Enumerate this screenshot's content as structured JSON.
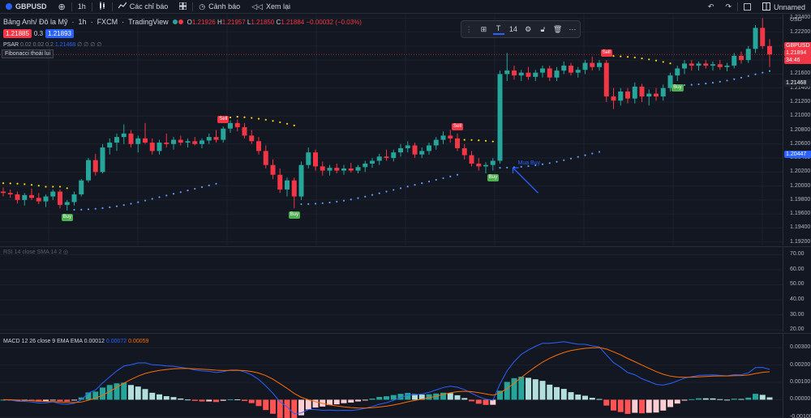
{
  "topbar": {
    "symbol": "GBPUSD",
    "interval": "1h",
    "indicators_label": "Các chỉ báo",
    "alerts_label": "Cảnh báo",
    "replay_label": "Xem lại",
    "layout_name": "Unnamed"
  },
  "legend": {
    "title": "Bảng Anh/ Đô la Mỹ",
    "interval": "1h",
    "exchange": "FXCM",
    "source": "TradingView",
    "o_label": "O",
    "o": "1.21926",
    "h_label": "H",
    "h": "1.21957",
    "l_label": "L",
    "l": "1.21850",
    "c_label": "C",
    "c": "1.21884",
    "change": "−0.00032 (−0.03%)",
    "bid": "1.21885",
    "spread": "0.3",
    "ask": "1.21893"
  },
  "psar": {
    "label": "PSAR",
    "params": "0.02 0.02 0.2",
    "value": "1.21468",
    "extra": "∅ ∅ ∅ ∅"
  },
  "fib_tag": "Fibonacci thoái lui",
  "drawing_toolbar": {
    "size": "14"
  },
  "signals": {
    "sell": "Sell",
    "buy": "Buy",
    "note": "Mua Buy"
  },
  "price_scale": {
    "currency": "USD",
    "ticks": [
      "1.22400",
      "1.22200",
      "1.22000",
      "1.21800",
      "1.21600",
      "1.21400",
      "1.21200",
      "1.21000",
      "1.20800",
      "1.20600",
      "1.20400",
      "1.20200",
      "1.20000",
      "1.19800",
      "1.19600",
      "1.19400",
      "1.19200"
    ],
    "symbol_label": "GBPUSD",
    "current_price": "1.21894",
    "countdown": "34:46",
    "psar_price": "1.21468",
    "crosshair_price": "1.20447"
  },
  "rsi": {
    "label": "RSI 14 close SMA 14 2",
    "ticks": [
      "70.00",
      "60.00",
      "50.00",
      "40.00",
      "30.00",
      "20.00"
    ]
  },
  "macd": {
    "label": "MACD 12 26 close 9 EMA EMA",
    "hist": "0.00012",
    "macd_line": "0.00072",
    "signal_line": "0.00059",
    "ticks": [
      "0.00300",
      "0.00200",
      "0.00100",
      "0.00000",
      "-0.00100"
    ]
  },
  "colors": {
    "up": "#26a69a",
    "down": "#f23645",
    "accent": "#2962ff",
    "macd": "#2962ff",
    "signal": "#ff6d00",
    "hist_up_strong": "#26a69a",
    "hist_up_weak": "#b2dfdb",
    "hist_down_strong": "#ff5252",
    "hist_down_weak": "#ffcdd2"
  },
  "chart_data": {
    "type": "candlestick",
    "price_range": [
      1.1915,
      1.2245
    ],
    "candles": [
      [
        1.1992,
        1.1998,
        1.1985,
        1.199
      ],
      [
        1.199,
        1.1995,
        1.1983,
        1.1988
      ],
      [
        1.1988,
        1.1992,
        1.1975,
        1.198
      ],
      [
        1.198,
        1.199,
        1.1972,
        1.1987
      ],
      [
        1.1987,
        1.1996,
        1.198,
        1.1983
      ],
      [
        1.1983,
        1.199,
        1.1974,
        1.1978
      ],
      [
        1.1978,
        1.1988,
        1.197,
        1.1985
      ],
      [
        1.1985,
        1.1995,
        1.198,
        1.1992
      ],
      [
        1.1992,
        1.1995,
        1.1968,
        1.1973
      ],
      [
        1.1973,
        1.198,
        1.1965,
        1.1977
      ],
      [
        1.1977,
        1.1992,
        1.1972,
        1.1988
      ],
      [
        1.1988,
        1.201,
        1.1985,
        1.2008
      ],
      [
        1.2008,
        1.204,
        1.2005,
        1.2037
      ],
      [
        1.2037,
        1.2046,
        1.2015,
        1.202
      ],
      [
        1.202,
        1.206,
        1.2018,
        1.2055
      ],
      [
        1.2055,
        1.2068,
        1.2045,
        1.2062
      ],
      [
        1.2062,
        1.2075,
        1.205,
        1.207
      ],
      [
        1.207,
        1.2088,
        1.206,
        1.2075
      ],
      [
        1.2075,
        1.208,
        1.2055,
        1.206
      ],
      [
        1.206,
        1.2072,
        1.2048,
        1.2068
      ],
      [
        1.2068,
        1.209,
        1.206,
        1.2062
      ],
      [
        1.2062,
        1.2068,
        1.2045,
        1.205
      ],
      [
        1.205,
        1.2066,
        1.2045,
        1.2062
      ],
      [
        1.2062,
        1.2075,
        1.2055,
        1.206
      ],
      [
        1.206,
        1.207,
        1.2052,
        1.2066
      ],
      [
        1.2066,
        1.2072,
        1.2058,
        1.2062
      ],
      [
        1.2062,
        1.2068,
        1.2055,
        1.2064
      ],
      [
        1.2064,
        1.207,
        1.2058,
        1.206
      ],
      [
        1.206,
        1.2068,
        1.2054,
        1.2065
      ],
      [
        1.2065,
        1.2075,
        1.206,
        1.207
      ],
      [
        1.207,
        1.208,
        1.2062,
        1.2066
      ],
      [
        1.2066,
        1.2085,
        1.2062,
        1.2082
      ],
      [
        1.2082,
        1.2094,
        1.2076,
        1.209
      ],
      [
        1.209,
        1.2095,
        1.2078,
        1.2084
      ],
      [
        1.2084,
        1.209,
        1.2068,
        1.2072
      ],
      [
        1.2072,
        1.208,
        1.206,
        1.2064
      ],
      [
        1.2064,
        1.207,
        1.2045,
        1.205
      ],
      [
        1.205,
        1.2058,
        1.2025,
        1.203
      ],
      [
        1.203,
        1.2038,
        1.201,
        1.2016
      ],
      [
        1.2016,
        1.2025,
        1.199,
        1.1995
      ],
      [
        1.1995,
        1.2012,
        1.1985,
        1.2008
      ],
      [
        1.2008,
        1.2012,
        1.1968,
        1.1985
      ],
      [
        1.1985,
        1.2035,
        1.198,
        1.203
      ],
      [
        1.203,
        1.2055,
        1.2025,
        1.2048
      ],
      [
        1.2048,
        1.2052,
        1.2022,
        1.2028
      ],
      [
        1.2028,
        1.2035,
        1.2015,
        1.2022
      ],
      [
        1.2022,
        1.203,
        1.2015,
        1.2026
      ],
      [
        1.2026,
        1.2032,
        1.2018,
        1.2022
      ],
      [
        1.2022,
        1.203,
        1.2016,
        1.2025
      ],
      [
        1.2025,
        1.2033,
        1.2019,
        1.2022
      ],
      [
        1.2022,
        1.203,
        1.2018,
        1.2027
      ],
      [
        1.2027,
        1.2036,
        1.202,
        1.2032
      ],
      [
        1.2032,
        1.204,
        1.2026,
        1.2036
      ],
      [
        1.2036,
        1.2046,
        1.203,
        1.2042
      ],
      [
        1.2042,
        1.2052,
        1.2036,
        1.204
      ],
      [
        1.204,
        1.2052,
        1.2035,
        1.2048
      ],
      [
        1.2048,
        1.206,
        1.2042,
        1.2054
      ],
      [
        1.2054,
        1.2064,
        1.2048,
        1.2058
      ],
      [
        1.2058,
        1.2062,
        1.204,
        1.2045
      ],
      [
        1.2045,
        1.2055,
        1.204,
        1.205
      ],
      [
        1.205,
        1.2062,
        1.2045,
        1.2058
      ],
      [
        1.2058,
        1.207,
        1.2052,
        1.2066
      ],
      [
        1.2066,
        1.2078,
        1.206,
        1.2072
      ],
      [
        1.2072,
        1.208,
        1.2062,
        1.2068
      ],
      [
        1.2068,
        1.2075,
        1.205,
        1.2054
      ],
      [
        1.2054,
        1.206,
        1.2038,
        1.2044
      ],
      [
        1.2044,
        1.205,
        1.2028,
        1.2032
      ],
      [
        1.2032,
        1.204,
        1.2022,
        1.2028
      ],
      [
        1.2028,
        1.2034,
        1.2018,
        1.203
      ],
      [
        1.203,
        1.204,
        1.2022,
        1.2036
      ],
      [
        1.2036,
        1.2165,
        1.2032,
        1.216
      ],
      [
        1.216,
        1.219,
        1.215,
        1.2165
      ],
      [
        1.2165,
        1.2172,
        1.2152,
        1.2158
      ],
      [
        1.2158,
        1.2166,
        1.215,
        1.2162
      ],
      [
        1.2162,
        1.217,
        1.2152,
        1.2156
      ],
      [
        1.2156,
        1.2166,
        1.215,
        1.2162
      ],
      [
        1.2162,
        1.2172,
        1.2155,
        1.2168
      ],
      [
        1.2168,
        1.2172,
        1.215,
        1.2155
      ],
      [
        1.2155,
        1.217,
        1.215,
        1.2165
      ],
      [
        1.2165,
        1.2178,
        1.216,
        1.2172
      ],
      [
        1.2172,
        1.2176,
        1.2158,
        1.2162
      ],
      [
        1.2162,
        1.217,
        1.2155,
        1.2166
      ],
      [
        1.2166,
        1.218,
        1.216,
        1.2176
      ],
      [
        1.2176,
        1.2185,
        1.2165,
        1.217
      ],
      [
        1.217,
        1.218,
        1.2165,
        1.2176
      ],
      [
        1.2176,
        1.218,
        1.212,
        1.2128
      ],
      [
        1.2128,
        1.214,
        1.211,
        1.2122
      ],
      [
        1.2122,
        1.214,
        1.2115,
        1.2135
      ],
      [
        1.2135,
        1.214,
        1.2118,
        1.2125
      ],
      [
        1.2125,
        1.2148,
        1.2118,
        1.2142
      ],
      [
        1.2142,
        1.2146,
        1.212,
        1.2128
      ],
      [
        1.2128,
        1.2138,
        1.2115,
        1.2132
      ],
      [
        1.2132,
        1.214,
        1.2122,
        1.2128
      ],
      [
        1.2128,
        1.2145,
        1.2122,
        1.214
      ],
      [
        1.214,
        1.2162,
        1.2135,
        1.2158
      ],
      [
        1.2158,
        1.2172,
        1.215,
        1.2168
      ],
      [
        1.2168,
        1.218,
        1.216,
        1.2175
      ],
      [
        1.2175,
        1.218,
        1.2165,
        1.2172
      ],
      [
        1.2172,
        1.2178,
        1.2165,
        1.2175
      ],
      [
        1.2175,
        1.218,
        1.2168,
        1.2172
      ],
      [
        1.2172,
        1.2178,
        1.2165,
        1.2174
      ],
      [
        1.2174,
        1.218,
        1.2166,
        1.217
      ],
      [
        1.217,
        1.2176,
        1.2164,
        1.2172
      ],
      [
        1.2172,
        1.219,
        1.2168,
        1.2186
      ],
      [
        1.2186,
        1.2192,
        1.2175,
        1.218
      ],
      [
        1.218,
        1.22,
        1.2176,
        1.2196
      ],
      [
        1.2196,
        1.223,
        1.219,
        1.2226
      ],
      [
        1.2226,
        1.224,
        1.2196,
        1.22
      ],
      [
        1.22,
        1.221,
        1.217,
        1.2188
      ]
    ]
  }
}
